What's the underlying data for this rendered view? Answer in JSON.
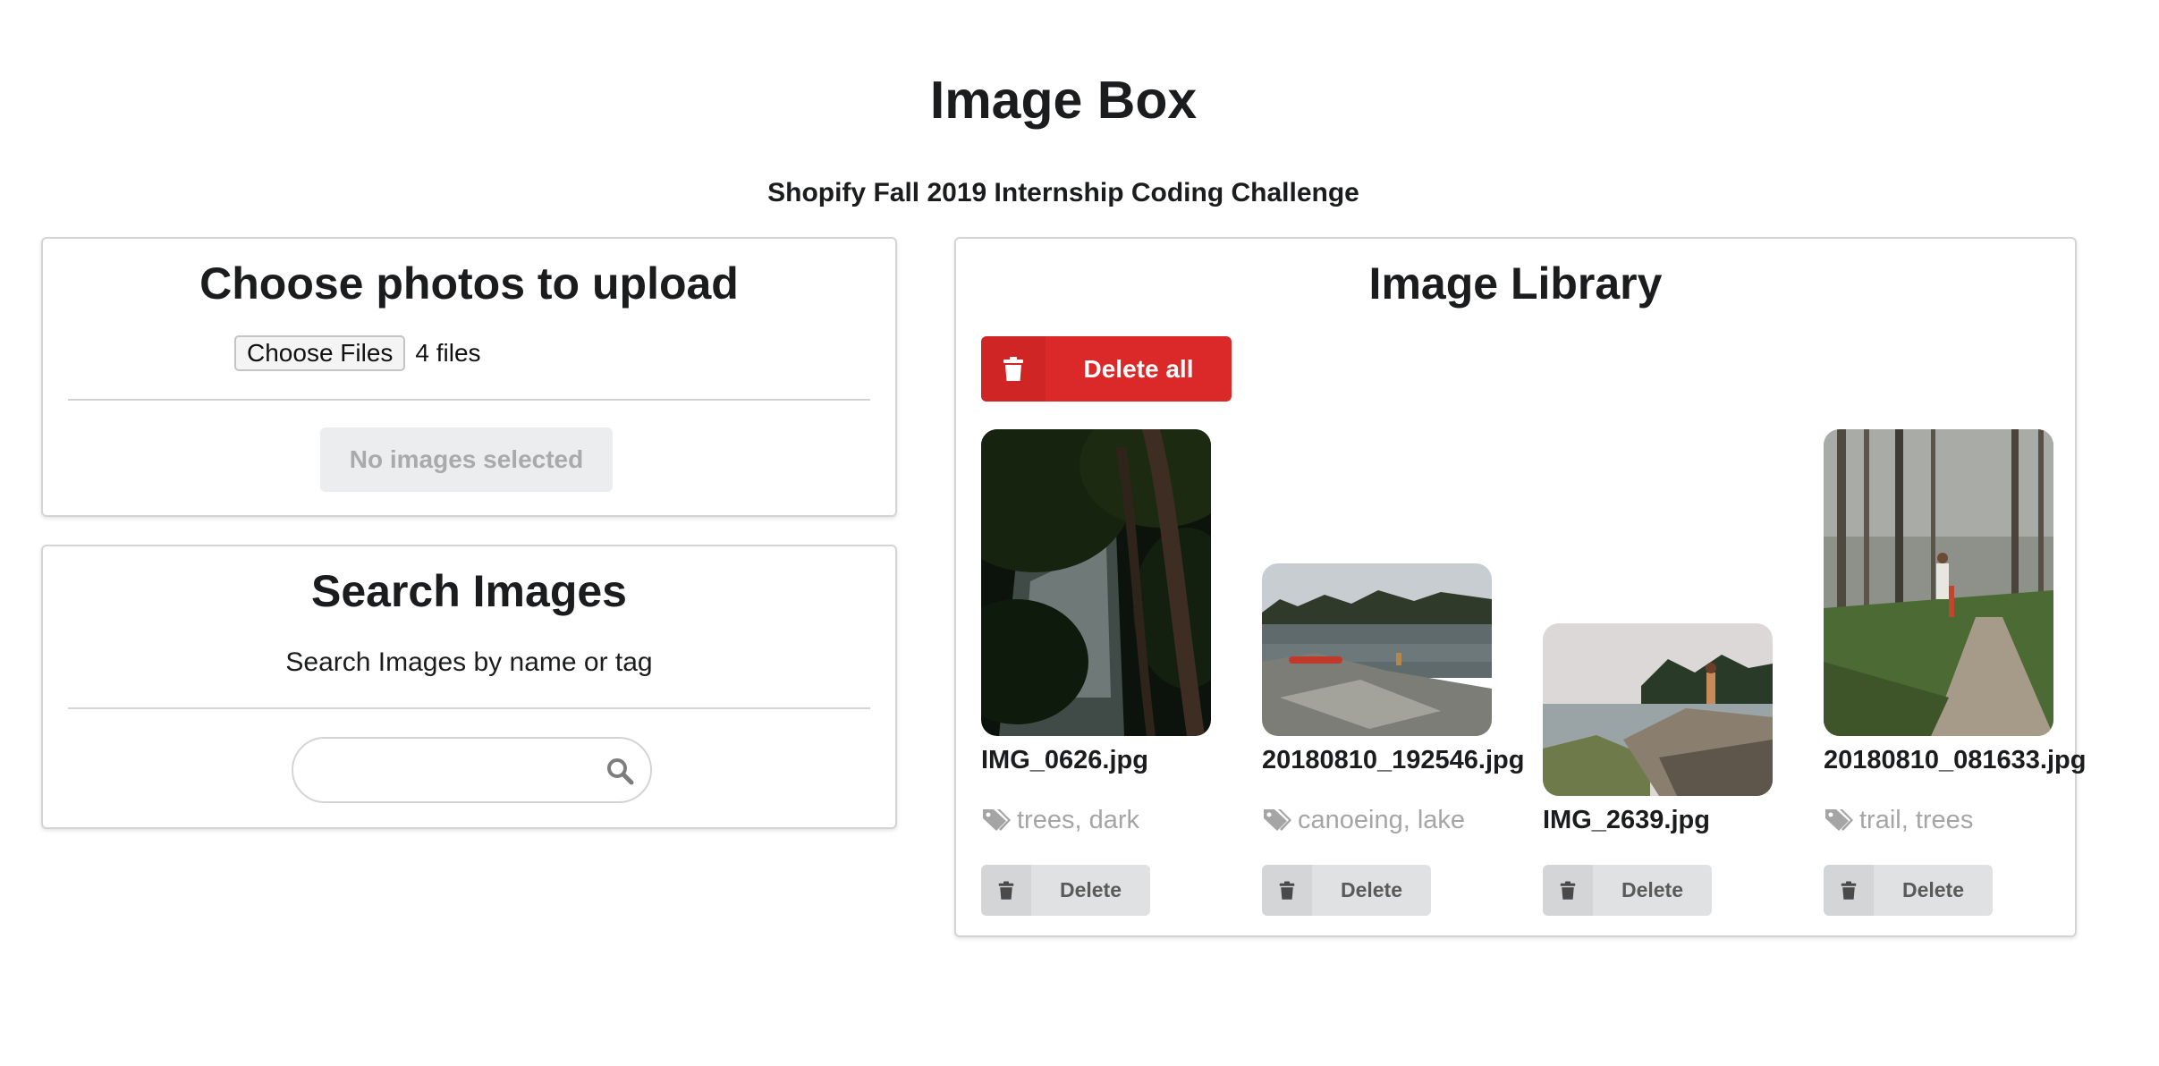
{
  "header": {
    "title": "Image Box",
    "subtitle": "Shopify Fall 2019 Internship Coding Challenge"
  },
  "upload": {
    "title": "Choose photos to upload",
    "file_button_label": "Choose Files",
    "file_count": "4 files",
    "submit_label": "No images selected"
  },
  "search": {
    "title": "Search Images",
    "hint": "Search Images by name or tag",
    "value": "",
    "icon": "search-icon"
  },
  "library": {
    "title": "Image Library",
    "delete_all_label": "Delete all",
    "accent_color": "#db2828",
    "images": [
      {
        "name": "IMG_0626.jpg",
        "tags": "trees, dark",
        "delete_label": "Delete"
      },
      {
        "name": "20180810_192546.jpg",
        "tags": "canoeing, lake",
        "delete_label": "Delete"
      },
      {
        "name": "IMG_2639.jpg",
        "tags": "",
        "delete_label": "Delete"
      },
      {
        "name": "20180810_081633.jpg",
        "tags": "trail, trees",
        "delete_label": "Delete"
      }
    ]
  }
}
